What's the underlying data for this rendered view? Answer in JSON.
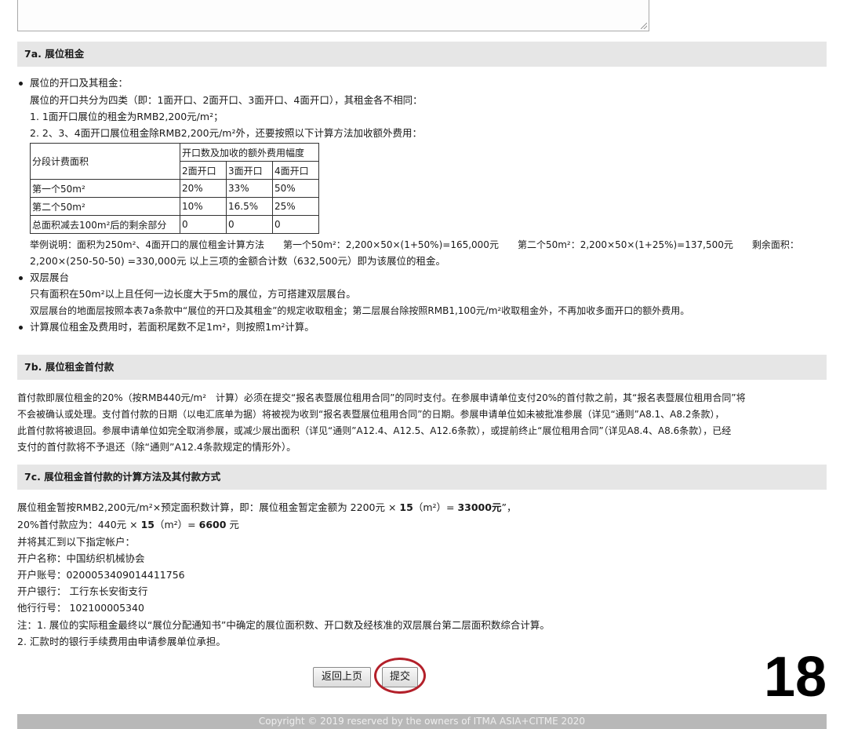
{
  "s7a": {
    "heading": "7a. 展位租金",
    "b1_title": "展位的开口及其租金：",
    "b1_line1": "展位的开口共分为四类（即：1面开口、2面开口、3面开口、4面开口），其租金各不相同：",
    "b1_line2": "1. 1面开口展位的租金为RMB2,200元/m²；",
    "b1_line3": "2. 2、3、4面开口展位租金除RMB2,200元/m²外，还要按照以下计算方法加收额外费用：",
    "table": {
      "col_area": "分段计费面积",
      "col_group": "开口数及加收的额外费用幅度",
      "col_2": "2面开口",
      "col_3": "3面开口",
      "col_4": "4面开口",
      "rows": [
        {
          "label": "第一个50m²",
          "v2": "20%",
          "v3": "33%",
          "v4": "50%"
        },
        {
          "label": "第二个50m²",
          "v2": "10%",
          "v3": "16.5%",
          "v4": "25%"
        },
        {
          "label": "总面积减去100m²后的剩余部分",
          "v2": "0",
          "v3": "0",
          "v4": "0"
        }
      ]
    },
    "example_1": "举例说明：面积为250m²、4面开口的展位租金计算方法　　第一个50m²：2,200×50×(1+50%)=165,000元　　第二个50m²：2,200×50×(1+25%)=137,500元　　剩余面积：",
    "example_2": "2,200×(250-50-50) =330,000元 以上三项的金额合计数（632,500元）即为该展位的租金。",
    "b2_title": "双层展台",
    "b2_line1": "只有面积在50m²以上且任何一边长度大于5m的展位，方可搭建双层展台。",
    "b2_line2": "双层展台的地面层按照本表7a条款中“展位的开口及其租金”的规定收取租金；第二层展台除按照RMB1,100元/m²收取租金外，不再加收多面开口的额外费用。",
    "b3": "计算展位租金及费用时，若面积尾数不足1m²，则按照1m²计算。"
  },
  "s7b": {
    "heading": "7b. 展位租金首付款",
    "p1": "首付款即展位租金的20%（按RMB440元/m²　计算）必须在提交“报名表暨展位租用合同”的同时支付。在参展申请单位支付20%的首付款之前，其“报名表暨展位租用合同”将",
    "p2": "不会被确认或处理。支付首付款的日期（以电汇底单为据）将被视为收到“报名表暨展位租用合同”的日期。参展申请单位如未被批准参展（详见“通则”A8.1、A8.2条款），",
    "p3": "此首付款将被退回。参展申请单位如完全取消参展，或减少展出面积（详见“通则”A12.4、A12.5、A12.6条款），或提前终止“展位租用合同”（详见A8.4、A8.6条款），已经",
    "p4": "支付的首付款将不予退还（除“通则”A12.4条款规定的情形外）。"
  },
  "s7c": {
    "heading": "7c. 展位租金首付款的计算方法及其付款方式",
    "l1_a": "展位租金暂按RMB2,200元/m²×预定面积数计算，即：展位租金暂定金额为 2200元 × ",
    "l1_qty": "15",
    "l1_b": "（m²）= ",
    "l1_total": "33000元",
    "l1_c": "”，",
    "l2_a": "20%首付款应为：440元 × ",
    "l2_qty": "15",
    "l2_b": "（m²）= ",
    "l2_total": "6600",
    "l2_c": " 元",
    "l3": "并将其汇到以下指定帐户：",
    "l4": "开户名称：中国纺织机械协会",
    "l5": "开户账号：0200053409014411756",
    "l6": "开户银行：  工行东长安街支行",
    "l7": "他行行号：  102100005340",
    "note1": "注：1. 展位的实际租金最终以“展位分配通知书”中确定的展位面积数、开口数及经核准的双层展台第二层面积数综合计算。",
    "note2": "2. 汇款时的银行手续费用由申请参展单位承担。"
  },
  "buttons": {
    "back": "返回上页",
    "submit": "提交"
  },
  "page_number": "18",
  "footer": "Copyright © 2019 reserved by the owners of ITMA ASIA+CITME 2020",
  "colors": {
    "section_bg": "#e6e6e6",
    "highlight_circle": "#b3202a",
    "footer_bg": "#b8b8b8"
  }
}
